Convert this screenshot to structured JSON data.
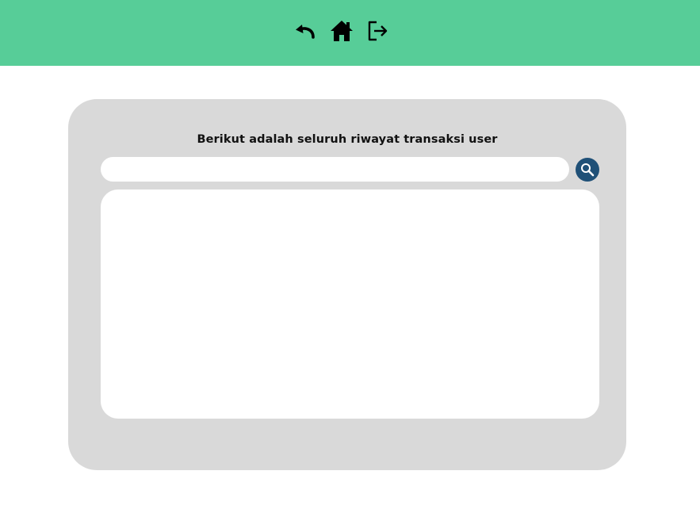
{
  "header": {
    "background_color": "#57cd98",
    "icons": [
      {
        "name": "undo-icon"
      },
      {
        "name": "home-icon"
      },
      {
        "name": "logout-icon"
      }
    ]
  },
  "main": {
    "title": "Berikut adalah seluruh riwayat transaksi user",
    "search": {
      "value": "",
      "placeholder": "",
      "button_icon": "search-icon",
      "button_color": "#1f5077"
    },
    "results": []
  }
}
